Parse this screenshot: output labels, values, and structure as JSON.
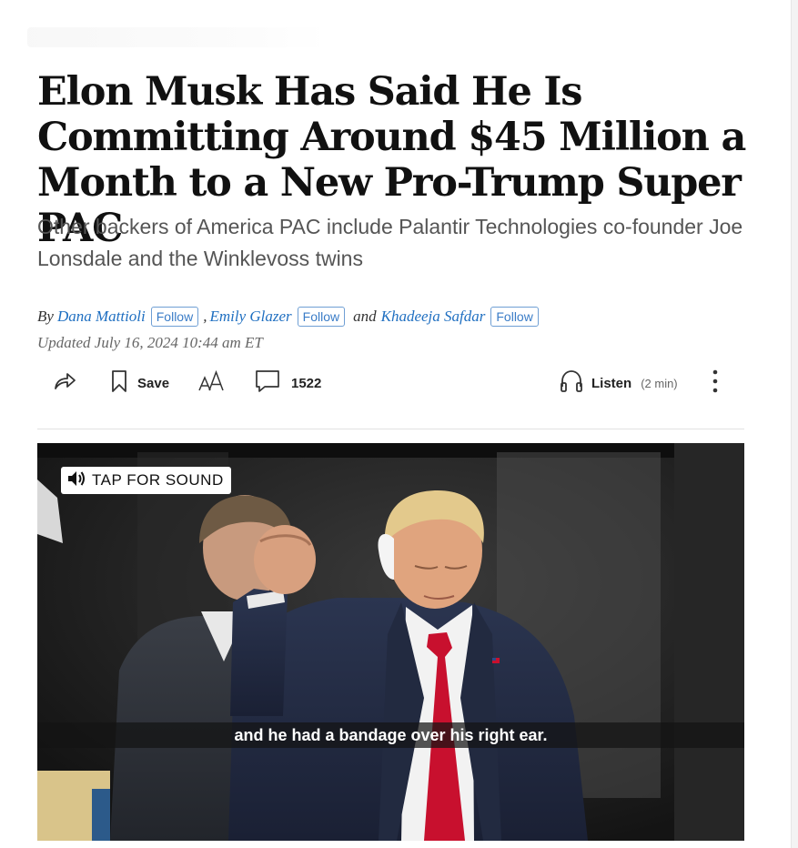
{
  "article": {
    "headline": "Elon Musk Has Said He Is Committing Around $45 Million a Month to a New Pro-Trump Super PAC",
    "dek": "Other backers of America PAC include Palantir Technologies co-founder Joe Lonsdale and the Winklevoss twins",
    "byline": {
      "by": "By",
      "authors": [
        {
          "name": "Dana Mattioli",
          "follow": "Follow"
        },
        {
          "name": "Emily Glazer",
          "follow": "Follow"
        },
        {
          "name": "Khadeeja Safdar",
          "follow": "Follow"
        }
      ],
      "comma": ",",
      "and": "and"
    },
    "updated": "Updated July 16, 2024 10:44 am ET"
  },
  "toolbar": {
    "share_icon": "share-arrow-icon",
    "save_icon": "bookmark-icon",
    "save_label": "Save",
    "text_size_icon": "text-size-icon",
    "text_size_label": "AA",
    "comment_icon": "comment-bubble-icon",
    "comment_count": "1522",
    "listen_icon": "headphones-icon",
    "listen_label": "Listen",
    "listen_duration": "(2 min)",
    "more_icon": "vertical-dots-icon"
  },
  "video": {
    "sound_button": "TAP FOR SOUND",
    "sound_icon": "speaker-icon",
    "caption": "and he had a bandage over his right ear."
  },
  "colors": {
    "link": "#1f6fc1",
    "text": "#111111",
    "dek": "#555555",
    "tie": "#c8102e"
  }
}
